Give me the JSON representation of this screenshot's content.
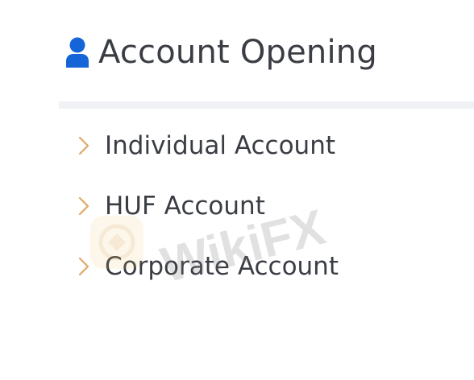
{
  "header": {
    "title": "Account Opening",
    "icon": "user-icon"
  },
  "menu": {
    "items": [
      {
        "label": "Individual Account",
        "icon": "chevron-right-icon"
      },
      {
        "label": "HUF Account",
        "icon": "chevron-right-icon"
      },
      {
        "label": "Corporate Account",
        "icon": "chevron-right-icon"
      }
    ]
  },
  "watermark": {
    "text": "WikiFX"
  },
  "colors": {
    "accent_blue": "#1565d8",
    "chevron_orange": "#e0a868",
    "text": "#3a3d43",
    "divider": "#f0f1f4"
  }
}
